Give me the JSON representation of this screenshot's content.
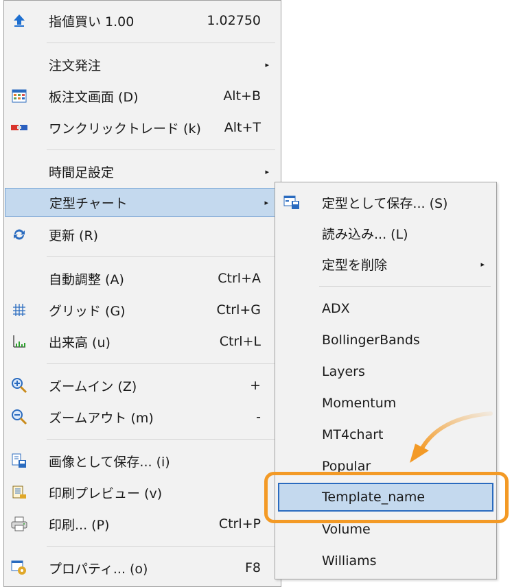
{
  "main_menu": {
    "items": [
      {
        "label": "指値買い 1.00",
        "shortcut": "1.02750",
        "icon": "arrow-up-icon"
      },
      {
        "label": "注文発注",
        "shortcut": "",
        "icon": ""
      },
      {
        "label": "板注文画面 (D)",
        "shortcut": "Alt+B",
        "icon": "order-board-icon"
      },
      {
        "label": "ワンクリックトレード (k)",
        "shortcut": "Alt+T",
        "icon": "one-click-trade-icon"
      },
      {
        "label": "時間足設定",
        "shortcut": "",
        "icon": ""
      },
      {
        "label": "定型チャート",
        "shortcut": "",
        "icon": ""
      },
      {
        "label": "更新 (R)",
        "shortcut": "",
        "icon": "refresh-icon"
      },
      {
        "label": "自動調整 (A)",
        "shortcut": "Ctrl+A",
        "icon": ""
      },
      {
        "label": "グリッド (G)",
        "shortcut": "Ctrl+G",
        "icon": "grid-icon"
      },
      {
        "label": "出来高 (u)",
        "shortcut": "Ctrl+L",
        "icon": "volume-icon"
      },
      {
        "label": "ズームイン (Z)",
        "shortcut": "+",
        "icon": "zoom-in-icon"
      },
      {
        "label": "ズームアウト (m)",
        "shortcut": "-",
        "icon": "zoom-out-icon"
      },
      {
        "label": "画像として保存... (i)",
        "shortcut": "",
        "icon": "save-image-icon"
      },
      {
        "label": "印刷プレビュー (v)",
        "shortcut": "",
        "icon": "print-preview-icon"
      },
      {
        "label": "印刷... (P)",
        "shortcut": "Ctrl+P",
        "icon": "print-icon"
      },
      {
        "label": "プロパティ... (o)",
        "shortcut": "F8",
        "icon": "properties-icon"
      }
    ],
    "submenu_arrow": "▸"
  },
  "sub_menu": {
    "items": [
      {
        "label": "定型として保存... (S)",
        "icon": "save-template-icon"
      },
      {
        "label": "読み込み... (L)"
      },
      {
        "label": "定型を削除"
      },
      {
        "label": "ADX"
      },
      {
        "label": "BollingerBands"
      },
      {
        "label": "Layers"
      },
      {
        "label": "Momentum"
      },
      {
        "label": "MT4chart"
      },
      {
        "label": "Popular"
      },
      {
        "label": "Template_name"
      },
      {
        "label": "Volume"
      },
      {
        "label": "Williams"
      }
    ]
  },
  "colors": {
    "highlight": "#c4d9ee",
    "callout": "#f39a26"
  }
}
